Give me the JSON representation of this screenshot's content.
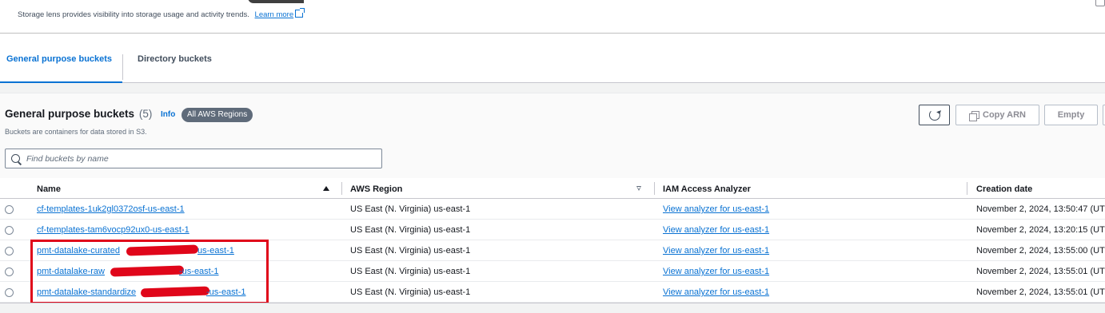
{
  "top": {
    "description": "Storage lens provides visibility into storage usage and activity trends.",
    "learn_more": "Learn more"
  },
  "tabs": [
    {
      "label": "General purpose buckets",
      "active": true
    },
    {
      "label": "Directory buckets",
      "active": false
    }
  ],
  "panel": {
    "title": "General purpose buckets",
    "count": "(5)",
    "info": "Info",
    "region_badge": "All AWS Regions",
    "description": "Buckets are containers for data stored in S3.",
    "search_placeholder": "Find buckets by name",
    "buttons": {
      "refresh_icon": "refresh-icon",
      "copy_arn": "Copy ARN",
      "empty": "Empty"
    }
  },
  "table": {
    "columns": [
      "Name",
      "AWS Region",
      "IAM Access Analyzer",
      "Creation date"
    ],
    "rows": [
      {
        "name_prefix": "cf-templates-1uk2gl0372osf-us-east-1",
        "name_suffix": "",
        "region": "US East (N. Virginia) us-east-1",
        "analyzer": "View analyzer for us-east-1",
        "created": "November 2, 2024, 13:50:47 (UT"
      },
      {
        "name_prefix": "cf-templates-tam6vocp92ux0-us-east-1",
        "name_suffix": "",
        "region": "US East (N. Virginia) us-east-1",
        "analyzer": "View analyzer for us-east-1",
        "created": "November 2, 2024, 13:20:15 (UT"
      },
      {
        "name_prefix": "pmt-datalake-curated",
        "name_suffix": "us-east-1",
        "region": "US East (N. Virginia) us-east-1",
        "analyzer": "View analyzer for us-east-1",
        "created": "November 2, 2024, 13:55:00 (UT"
      },
      {
        "name_prefix": "pmt-datalake-raw",
        "name_suffix": "-us-east-1",
        "region": "US East (N. Virginia) us-east-1",
        "analyzer": "View analyzer for us-east-1",
        "created": "November 2, 2024, 13:55:01 (UT"
      },
      {
        "name_prefix": "pmt-datalake-standardize",
        "name_suffix": "-us-east-1",
        "region": "US East (N. Virginia) us-east-1",
        "analyzer": "View analyzer for us-east-1",
        "created": "November 2, 2024, 13:55:01 (UT"
      }
    ]
  },
  "colors": {
    "link": "#0972d3",
    "annotation_red": "#e0061a",
    "badge": "#5f6b7a"
  }
}
